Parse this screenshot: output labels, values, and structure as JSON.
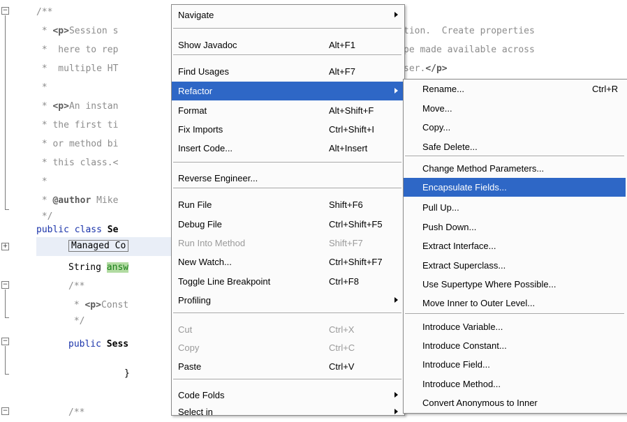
{
  "editor": {
    "lines": [
      "/**",
      " * ",
      " *  here to rep",
      " *  multiple HT",
      " *",
      " * ",
      " * the first ti",
      " * or method bi",
      " * this class.<",
      " *",
      " * ",
      " */",
      "public class ",
      "Managed Co",
      "String ",
      "/**",
      " * ",
      " */",
      "public ",
      "}",
      "/**"
    ],
    "line2_tag": "<p>",
    "line2_rest": "Session s",
    "line6_tag": "<p>",
    "line6_rest": "An instan",
    "line11_tag": "@author",
    "line11_rest": " Mike",
    "line13_name": "Se",
    "line15_field": "answ",
    "line17_tag": "<p>",
    "line17_rest": "Const",
    "line19_name": "Sess",
    "right_line1": "tion.  Create properties",
    "right_line2": "pe made available across",
    "right_line3_a": "ser.",
    "right_line3_tag": "</p>",
    "right_line3_b": ">"
  },
  "context_menu": {
    "items": [
      {
        "label": "Navigate",
        "shortcut": "",
        "submenu": true
      },
      {
        "label": "Show Javadoc",
        "shortcut": "Alt+F1"
      },
      {
        "label": "Find Usages",
        "shortcut": "Alt+F7"
      },
      {
        "label": "Refactor",
        "shortcut": "",
        "submenu": true,
        "selected": true
      },
      {
        "label": "Format",
        "shortcut": "Alt+Shift+F"
      },
      {
        "label": "Fix Imports",
        "shortcut": "Ctrl+Shift+I"
      },
      {
        "label": "Insert Code...",
        "shortcut": "Alt+Insert"
      },
      {
        "label": "Reverse Engineer...",
        "shortcut": ""
      },
      {
        "label": "Run File",
        "shortcut": "Shift+F6"
      },
      {
        "label": "Debug File",
        "shortcut": "Ctrl+Shift+F5"
      },
      {
        "label": "Run Into Method",
        "shortcut": "Shift+F7",
        "disabled": true
      },
      {
        "label": "New Watch...",
        "shortcut": "Ctrl+Shift+F7"
      },
      {
        "label": "Toggle Line Breakpoint",
        "shortcut": "Ctrl+F8"
      },
      {
        "label": "Profiling",
        "shortcut": "",
        "submenu": true
      },
      {
        "label": "Cut",
        "shortcut": "Ctrl+X",
        "disabled": true
      },
      {
        "label": "Copy",
        "shortcut": "Ctrl+C",
        "disabled": true
      },
      {
        "label": "Paste",
        "shortcut": "Ctrl+V"
      },
      {
        "label": "Code Folds",
        "shortcut": "",
        "submenu": true
      },
      {
        "label": "Select in",
        "shortcut": "",
        "submenu": true
      }
    ]
  },
  "refactor_submenu": {
    "items": [
      {
        "label": "Rename...",
        "shortcut": "Ctrl+R"
      },
      {
        "label": "Move...",
        "shortcut": ""
      },
      {
        "label": "Copy...",
        "shortcut": ""
      },
      {
        "label": "Safe Delete...",
        "shortcut": ""
      },
      {
        "label": "Change Method Parameters...",
        "shortcut": ""
      },
      {
        "label": "Encapsulate Fields...",
        "shortcut": "",
        "selected": true
      },
      {
        "label": "Pull Up...",
        "shortcut": ""
      },
      {
        "label": "Push Down...",
        "shortcut": ""
      },
      {
        "label": "Extract Interface...",
        "shortcut": ""
      },
      {
        "label": "Extract Superclass...",
        "shortcut": ""
      },
      {
        "label": "Use Supertype Where Possible...",
        "shortcut": ""
      },
      {
        "label": "Move Inner to Outer Level...",
        "shortcut": ""
      },
      {
        "label": "Introduce Variable...",
        "shortcut": ""
      },
      {
        "label": "Introduce Constant...",
        "shortcut": ""
      },
      {
        "label": "Introduce Field...",
        "shortcut": ""
      },
      {
        "label": "Introduce Method...",
        "shortcut": ""
      },
      {
        "label": "Convert Anonymous to Inner",
        "shortcut": ""
      }
    ]
  },
  "colors": {
    "selection": "#2e67c6",
    "comment": "#8c8c8c",
    "keyword": "#1a33aa",
    "field_highlight": "#b2dba2"
  }
}
